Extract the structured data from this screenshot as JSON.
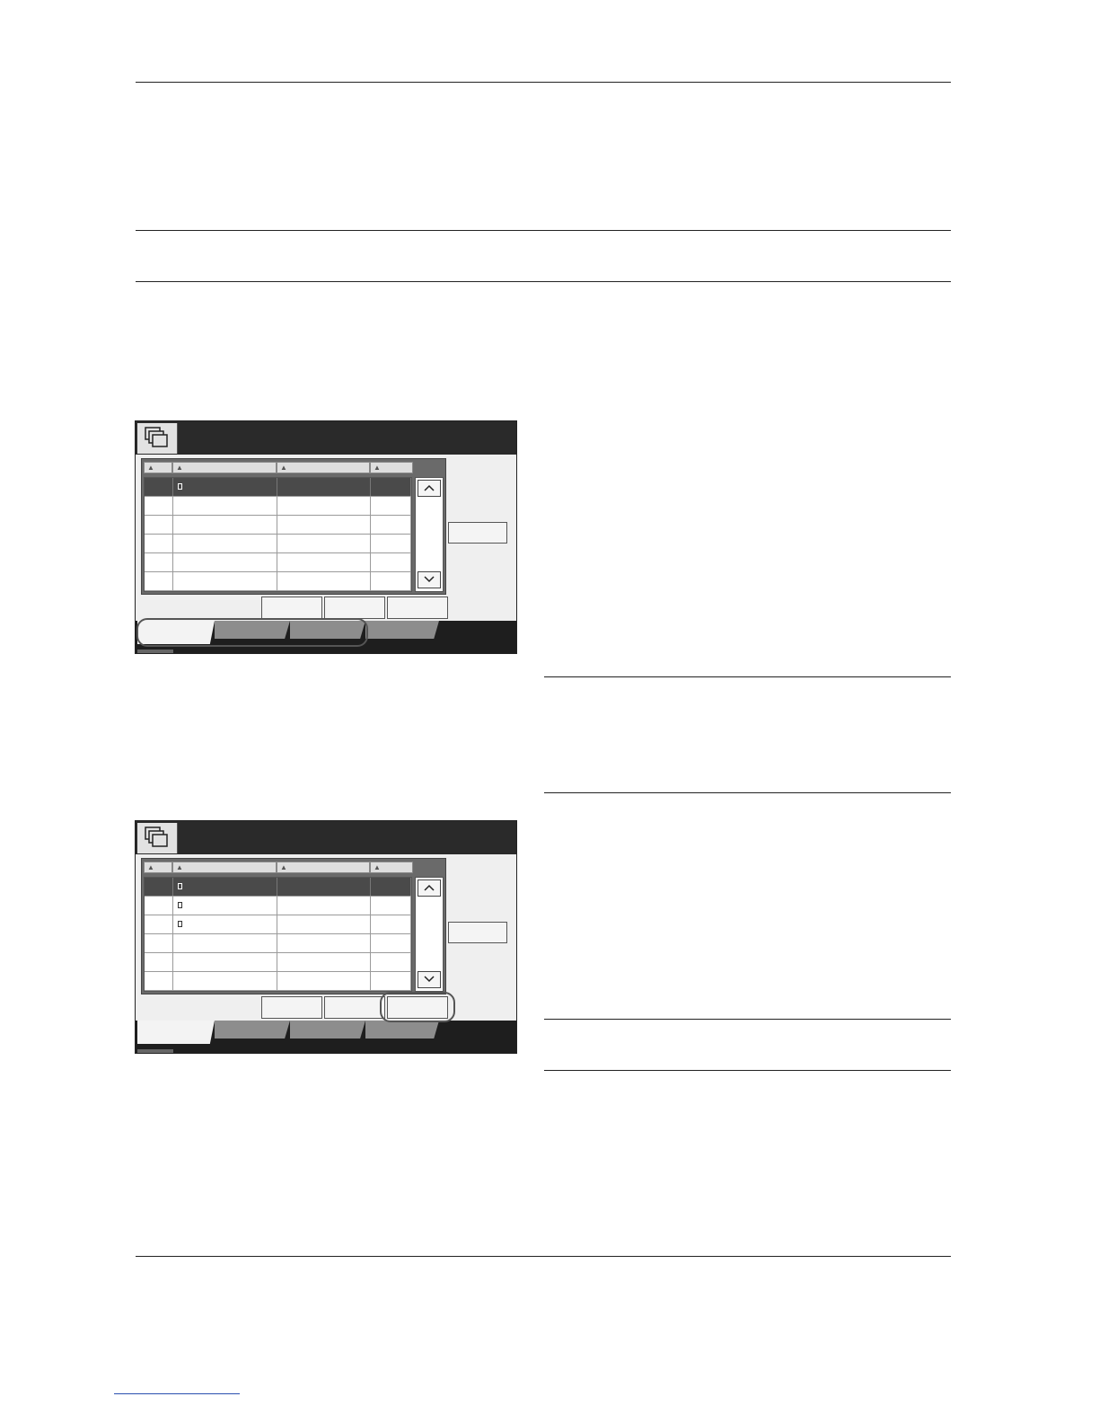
{
  "page": {
    "background": "#ffffff",
    "rule_color": "#222222",
    "link_color": "#2a4fb0"
  },
  "screens": [
    {
      "name": "document-box-list-screen",
      "icon": "stacked-folders-icon",
      "columns": [
        "",
        "",
        "",
        ""
      ],
      "rows": [
        {
          "selected": true,
          "has_doc_icon": true
        },
        {
          "selected": false,
          "has_doc_icon": false
        },
        {
          "selected": false,
          "has_doc_icon": false
        },
        {
          "selected": false,
          "has_doc_icon": false
        },
        {
          "selected": false,
          "has_doc_icon": false
        },
        {
          "selected": false,
          "has_doc_icon": false
        }
      ],
      "scroll_up_glyph": "^",
      "scroll_down_glyph": "v",
      "highlighted_control": "tab-group"
    },
    {
      "name": "document-box-list-screen-multi",
      "icon": "stacked-folders-icon",
      "columns": [
        "",
        "",
        "",
        ""
      ],
      "rows": [
        {
          "selected": true,
          "has_doc_icon": true
        },
        {
          "selected": false,
          "has_doc_icon": true
        },
        {
          "selected": false,
          "has_doc_icon": true
        },
        {
          "selected": false,
          "has_doc_icon": false
        },
        {
          "selected": false,
          "has_doc_icon": false
        },
        {
          "selected": false,
          "has_doc_icon": false
        }
      ],
      "scroll_up_glyph": "^",
      "scroll_down_glyph": "v",
      "highlighted_control": "third-bottom-button"
    }
  ]
}
